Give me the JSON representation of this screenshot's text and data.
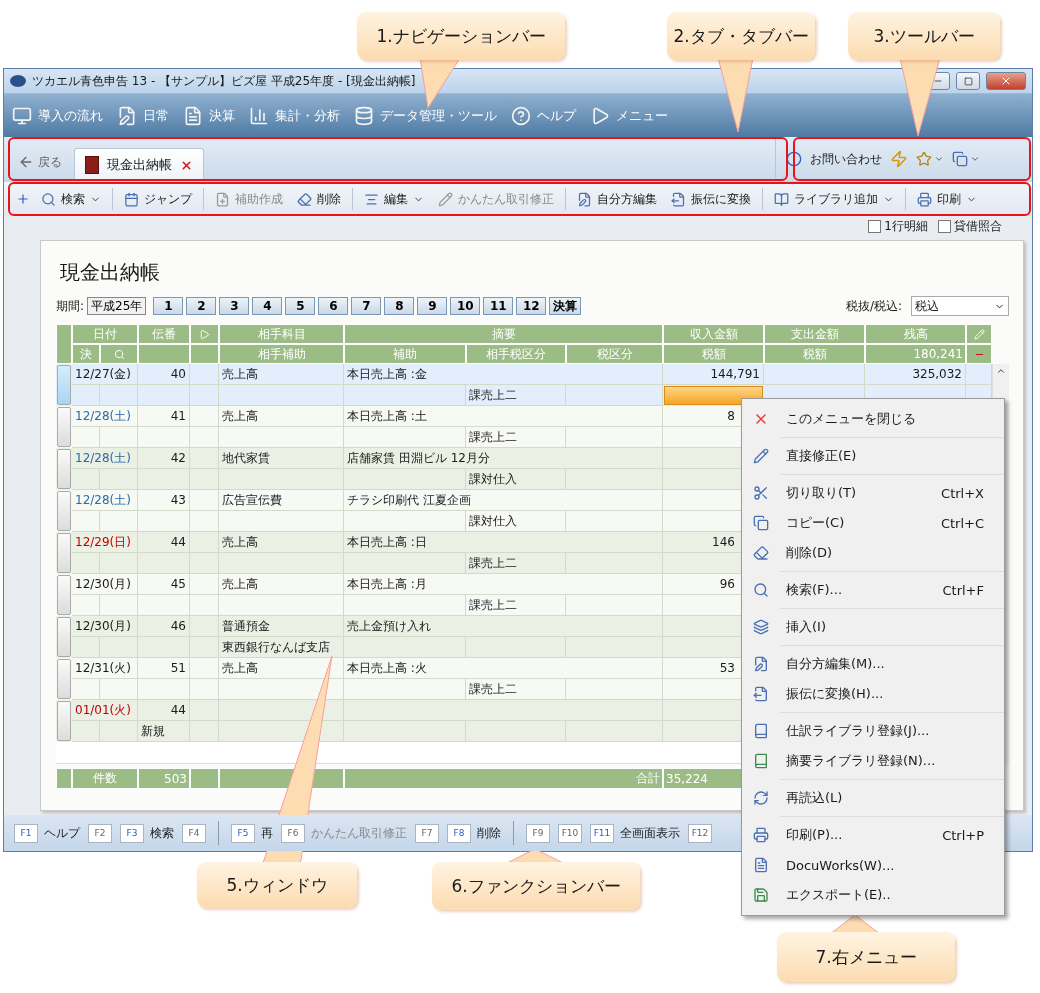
{
  "callouts": [
    {
      "text": "1.ナビゲーションバー"
    },
    {
      "text": "2.タブ・タブバー"
    },
    {
      "text": "3.ツールバー"
    },
    {
      "text": "5.ウィンドウ"
    },
    {
      "text": "6.ファンクションバー"
    },
    {
      "text": "7.右メニュー"
    }
  ],
  "window": {
    "title": "ツカエル青色申告 13 - 【サンプル】ビズ屋 平成25年度 - [現金出納帳]"
  },
  "nav_bar": {
    "items": [
      {
        "label": "導入の流れ"
      },
      {
        "label": "日常"
      },
      {
        "label": "決算"
      },
      {
        "label": "集計・分析"
      },
      {
        "label": "データ管理・ツール"
      },
      {
        "label": "ヘルプ"
      },
      {
        "label": "メニュー"
      }
    ]
  },
  "tab_bar": {
    "back": "戻る",
    "tabs": [
      {
        "label": "現金出納帳",
        "selected": true
      }
    ],
    "contact": "お問い合わせ"
  },
  "toolbar": {
    "items": [
      {
        "kind": "button",
        "label": "検索",
        "dropdown": true,
        "disabled": false
      },
      {
        "kind": "separator"
      },
      {
        "kind": "button",
        "label": "ジャンプ",
        "dropdown": false,
        "disabled": false
      },
      {
        "kind": "separator"
      },
      {
        "kind": "button",
        "label": "補助作成",
        "dropdown": false,
        "disabled": true
      },
      {
        "kind": "button",
        "label": "削除",
        "dropdown": false,
        "disabled": false
      },
      {
        "kind": "separator"
      },
      {
        "kind": "button",
        "label": "編集",
        "dropdown": true,
        "disabled": false
      },
      {
        "kind": "button",
        "label": "かんたん取引修正",
        "dropdown": false,
        "disabled": true
      },
      {
        "kind": "separator"
      },
      {
        "kind": "button",
        "label": "自分方編集",
        "dropdown": false,
        "disabled": false
      },
      {
        "kind": "button",
        "label": "振伝に変換",
        "dropdown": false,
        "disabled": false
      },
      {
        "kind": "separator"
      },
      {
        "kind": "button",
        "label": "ライブラリ追加",
        "dropdown": true,
        "disabled": false
      },
      {
        "kind": "separator"
      },
      {
        "kind": "button",
        "label": "印刷",
        "dropdown": true,
        "disabled": false
      }
    ]
  },
  "options": [
    {
      "label": "1行明細",
      "checked": false
    },
    {
      "label": "貸借照合",
      "checked": false
    }
  ],
  "ledger": {
    "title": "現金出納帳",
    "period_label": "期間:",
    "year": "平成25年",
    "months": [
      "1",
      "2",
      "3",
      "4",
      "5",
      "6",
      "7",
      "8",
      "9",
      "10",
      "11",
      "12"
    ],
    "closing": "決算",
    "tax_label": "税抜/税込:",
    "tax_mode": "税込",
    "header_top": [
      "日付",
      "伝番",
      "相手科目",
      "摘要",
      "収入金額",
      "支出金額",
      "残高"
    ],
    "header_bottom": [
      "決",
      "相手補助",
      "補助",
      "相手税区分",
      "税区分",
      "税額",
      "税額"
    ],
    "carried_balance": "180,241",
    "rows": [
      {
        "date": "12/27(金)",
        "color": "#1a1a1a",
        "number": "40",
        "account": "売上高",
        "description": "本日売上高 :金",
        "tax_class": "課売上二",
        "income": "144,791",
        "balance": "325,032",
        "selected": true
      },
      {
        "date": "12/28(土)",
        "color": "#2a6aa8",
        "number": "41",
        "account": "売上高",
        "description": "本日売上高 :土",
        "tax_class": "課売上二",
        "income": "8",
        "selected": false
      },
      {
        "date": "12/28(土)",
        "color": "#2a6aa8",
        "number": "42",
        "account": "地代家賃",
        "description": "店舗家賃 田淵ビル 12月分",
        "tax_class": "課対仕入",
        "selected": false
      },
      {
        "date": "12/28(土)",
        "color": "#2a6aa8",
        "number": "43",
        "account": "広告宣伝費",
        "description": "チラシ印刷代 江夏企画",
        "tax_class": "課対仕入",
        "selected": false
      },
      {
        "date": "12/29(日)",
        "color": "#c00000",
        "number": "44",
        "account": "売上高",
        "description": "本日売上高 :日",
        "tax_class": "課売上二",
        "income": "146",
        "selected": false
      },
      {
        "date": "12/30(月)",
        "color": "#1a1a1a",
        "number": "45",
        "account": "売上高",
        "description": "本日売上高 :月",
        "tax_class": "課売上二",
        "income": "96",
        "selected": false
      },
      {
        "date": "12/30(月)",
        "color": "#1a1a1a",
        "number": "46",
        "account": "普通預金",
        "description": "売上金預け入れ",
        "sub_account": "東西銀行なんば支店",
        "selected": false
      },
      {
        "date": "12/31(火)",
        "color": "#1a1a1a",
        "number": "51",
        "account": "売上高",
        "description": "本日売上高 :火",
        "tax_class": "課売上二",
        "income": "53",
        "selected": false
      },
      {
        "date": "01/01(火)",
        "color": "#c00000",
        "number": "44",
        "note": "新規",
        "selected": false
      }
    ],
    "footer": {
      "count_label": "件数",
      "count": "503",
      "total_label": "合計",
      "total": "35,224"
    }
  },
  "function_bar": {
    "groups": [
      [
        {
          "key": "F1",
          "label": "ヘルプ",
          "enabled": true
        },
        {
          "key": "F2",
          "enabled": false
        },
        {
          "key": "F3",
          "label": "検索",
          "enabled": true
        },
        {
          "key": "F4",
          "enabled": false
        }
      ],
      [
        {
          "key": "F5",
          "label": "再",
          "enabled": true
        },
        {
          "key": "F6",
          "label": "かんたん取引修正",
          "enabled": false
        },
        {
          "key": "F7",
          "enabled": false
        },
        {
          "key": "F8",
          "label": "削除",
          "enabled": true
        }
      ],
      [
        {
          "key": "F9",
          "enabled": false
        },
        {
          "key": "F10",
          "enabled": false
        },
        {
          "key": "F11",
          "label": "全画面表示",
          "enabled": true
        },
        {
          "key": "F12",
          "enabled": false
        }
      ]
    ]
  },
  "context_menu": {
    "groups": [
      [
        {
          "label": "このメニューを閉じる"
        }
      ],
      [
        {
          "label": "直接修正(E)"
        }
      ],
      [
        {
          "label": "切り取り(T)",
          "shortcut": "Ctrl+X"
        },
        {
          "label": "コピー(C)",
          "shortcut": "Ctrl+C"
        },
        {
          "label": "削除(D)"
        }
      ],
      [
        {
          "label": "検索(F)...",
          "shortcut": "Ctrl+F"
        }
      ],
      [
        {
          "label": "挿入(I)"
        }
      ],
      [
        {
          "label": "自分方編集(M)..."
        },
        {
          "label": "振伝に変換(H)..."
        }
      ],
      [
        {
          "label": "仕訳ライブラリ登録(J)..."
        },
        {
          "label": "摘要ライブラリ登録(N)..."
        }
      ],
      [
        {
          "label": "再読込(L)"
        }
      ],
      [
        {
          "label": "印刷(P)...",
          "shortcut": "Ctrl+P"
        },
        {
          "label": "DocuWorks(W)..."
        },
        {
          "label": "エクスポート(E).."
        }
      ]
    ]
  }
}
